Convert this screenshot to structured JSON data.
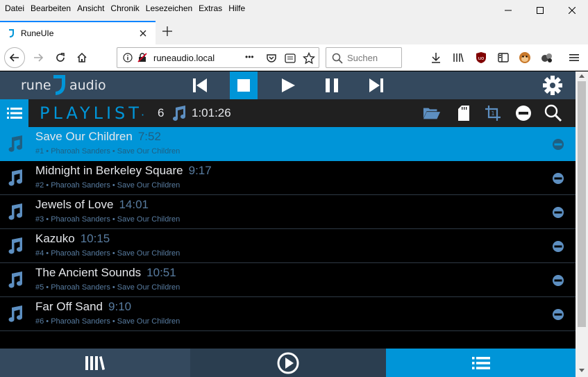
{
  "browser": {
    "menu": [
      "Datei",
      "Bearbeiten",
      "Ansicht",
      "Chronik",
      "Lesezeichen",
      "Extras",
      "Hilfe"
    ],
    "tab_title": "RuneUIe",
    "url": "runeaudio.local",
    "search_placeholder": "Suchen",
    "more_dots": "•••"
  },
  "app": {
    "logo_left": "rune",
    "logo_right": "audio",
    "playlist_title": "PLAYLIST",
    "playlist_dot": "·",
    "track_count": "6",
    "total_time": "1:01:26",
    "accent_color": "#0095d8",
    "bar_color": "#34495e",
    "tracks": [
      {
        "title": "Save Our Children",
        "time": "7:52",
        "meta": "#1 • Pharoah Sanders • Save Our Children",
        "active": true
      },
      {
        "title": "Midnight in Berkeley Square",
        "time": "9:17",
        "meta": "#2 • Pharoah Sanders • Save Our Children",
        "active": false
      },
      {
        "title": "Jewels of Love",
        "time": "14:01",
        "meta": "#3 • Pharoah Sanders • Save Our Children",
        "active": false
      },
      {
        "title": "Kazuko",
        "time": "10:15",
        "meta": "#4 • Pharoah Sanders • Save Our Children",
        "active": false
      },
      {
        "title": "The Ancient Sounds",
        "time": "10:51",
        "meta": "#5 • Pharoah Sanders • Save Our Children",
        "active": false
      },
      {
        "title": "Far Off Sand",
        "time": "9:10",
        "meta": "#6 • Pharoah Sanders • Save Our Children",
        "active": false
      }
    ],
    "icons": [
      "rune-logo-icon",
      "previous-icon",
      "stop-icon",
      "play-icon",
      "pause-icon",
      "next-icon",
      "settings-gear-icon",
      "list-menu-icon",
      "music-note-icon",
      "folder-open-icon",
      "sd-card-icon",
      "crop-icon",
      "remove-circle-icon",
      "search-icon",
      "library-icon",
      "play-circle-icon",
      "playlist-icon"
    ]
  }
}
